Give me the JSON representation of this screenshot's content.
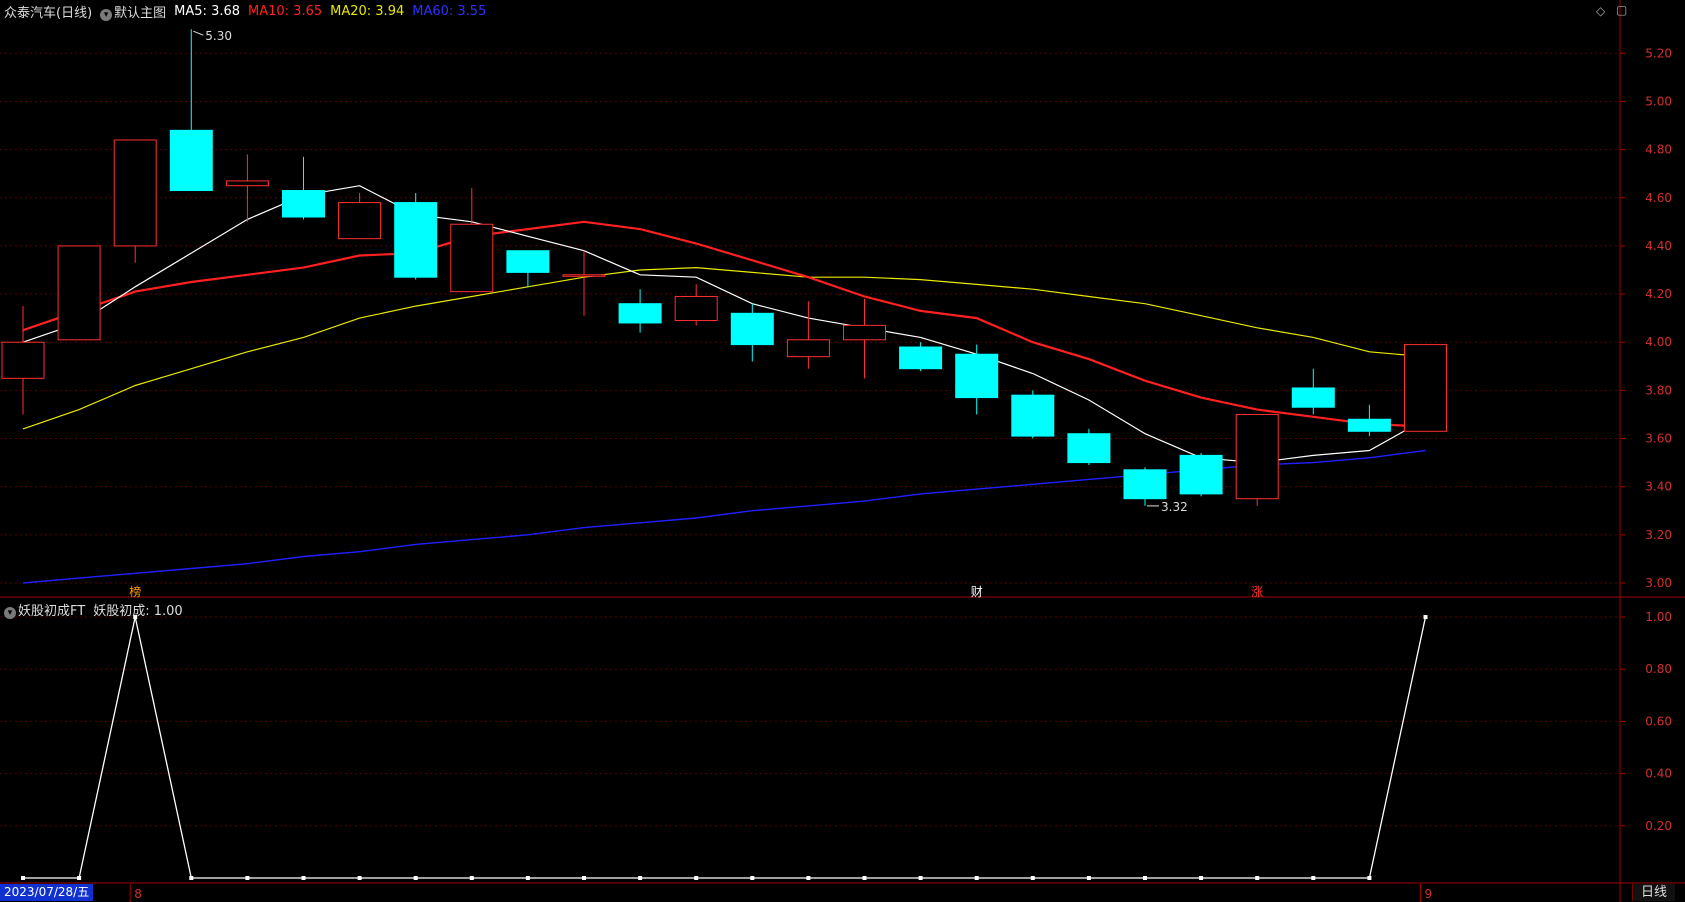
{
  "header": {
    "stock_name": "众泰汽车(日线)",
    "template_name": "默认主图",
    "ma5": {
      "label": "MA5: 3.68",
      "color": "#ffffff"
    },
    "ma10": {
      "label": "MA10: 3.65",
      "color": "#ff2020"
    },
    "ma20": {
      "label": "MA20: 3.94",
      "color": "#e8e800"
    },
    "ma60": {
      "label": "MA60: 3.55",
      "color": "#2020ff"
    },
    "controls": [
      "◇",
      "▢"
    ]
  },
  "sub_header": {
    "indicator_name": "妖股初成FT",
    "value_label": "妖股初成: 1.00"
  },
  "colors": {
    "up": "#ff3030",
    "down": "#00ffff",
    "axis": "#a00000",
    "grid": "#5a0000",
    "indicator_line": "#ffffff"
  },
  "price_axis": {
    "ticks": [
      "5.20",
      "5.00",
      "4.80",
      "4.60",
      "4.40",
      "4.20",
      "4.00",
      "3.80",
      "3.60",
      "3.40",
      "3.20",
      "3.00"
    ],
    "min": 2.95,
    "max": 5.33
  },
  "indicator_axis": {
    "ticks": [
      "1.00",
      "0.80",
      "0.60",
      "0.40",
      "0.20"
    ],
    "min": 0,
    "max": 1.05
  },
  "annotations": {
    "high_label": "5.30",
    "low_label": "3.32",
    "event_markers": [
      {
        "bar_index": 2,
        "text": "榜",
        "color": "#ff9900"
      },
      {
        "bar_index": 17,
        "text": "财",
        "color": "#ffffff"
      },
      {
        "bar_index": 22,
        "text": "涨",
        "color": "#ff3030"
      }
    ]
  },
  "chart_data": {
    "type": "candlestick",
    "ohlc": [
      {
        "o": 3.85,
        "h": 4.15,
        "l": 3.7,
        "c": 4.0
      },
      {
        "o": 4.01,
        "h": 4.4,
        "l": 4.01,
        "c": 4.4
      },
      {
        "o": 4.4,
        "h": 4.84,
        "l": 4.33,
        "c": 4.84
      },
      {
        "o": 4.88,
        "h": 5.3,
        "l": 4.63,
        "c": 4.63
      },
      {
        "o": 4.65,
        "h": 4.78,
        "l": 4.5,
        "c": 4.67
      },
      {
        "o": 4.63,
        "h": 4.77,
        "l": 4.51,
        "c": 4.52
      },
      {
        "o": 4.43,
        "h": 4.62,
        "l": 4.43,
        "c": 4.58
      },
      {
        "o": 4.58,
        "h": 4.62,
        "l": 4.26,
        "c": 4.27
      },
      {
        "o": 4.21,
        "h": 4.64,
        "l": 4.21,
        "c": 4.49
      },
      {
        "o": 4.38,
        "h": 4.38,
        "l": 4.23,
        "c": 4.29
      },
      {
        "o": 4.28,
        "h": 4.38,
        "l": 4.11,
        "c": 4.28
      },
      {
        "o": 4.16,
        "h": 4.22,
        "l": 4.04,
        "c": 4.08
      },
      {
        "o": 4.09,
        "h": 4.24,
        "l": 4.07,
        "c": 4.19
      },
      {
        "o": 4.12,
        "h": 4.16,
        "l": 3.92,
        "c": 3.99
      },
      {
        "o": 3.94,
        "h": 4.17,
        "l": 3.89,
        "c": 4.01
      },
      {
        "o": 4.01,
        "h": 4.18,
        "l": 3.85,
        "c": 4.07
      },
      {
        "o": 3.98,
        "h": 4.0,
        "l": 3.88,
        "c": 3.89
      },
      {
        "o": 3.95,
        "h": 3.99,
        "l": 3.7,
        "c": 3.77
      },
      {
        "o": 3.78,
        "h": 3.8,
        "l": 3.6,
        "c": 3.61
      },
      {
        "o": 3.62,
        "h": 3.64,
        "l": 3.49,
        "c": 3.5
      },
      {
        "o": 3.47,
        "h": 3.48,
        "l": 3.32,
        "c": 3.35
      },
      {
        "o": 3.53,
        "h": 3.54,
        "l": 3.36,
        "c": 3.37
      },
      {
        "o": 3.35,
        "h": 3.7,
        "l": 3.32,
        "c": 3.7
      },
      {
        "o": 3.81,
        "h": 3.89,
        "l": 3.7,
        "c": 3.73
      },
      {
        "o": 3.68,
        "h": 3.74,
        "l": 3.61,
        "c": 3.63
      },
      {
        "o": 3.63,
        "h": 3.99,
        "l": 3.63,
        "c": 3.99
      }
    ],
    "series": [
      {
        "name": "MA5",
        "values": [
          4.0,
          4.08,
          4.23,
          4.37,
          4.51,
          4.61,
          4.65,
          4.53,
          4.5,
          4.44,
          4.38,
          4.28,
          4.27,
          4.16,
          4.1,
          4.06,
          4.02,
          3.95,
          3.87,
          3.76,
          3.62,
          3.52,
          3.5,
          3.53,
          3.55,
          3.68
        ]
      },
      {
        "name": "MA10",
        "values": [
          4.05,
          4.13,
          4.21,
          4.25,
          4.28,
          4.31,
          4.36,
          4.37,
          4.44,
          4.47,
          4.5,
          4.47,
          4.41,
          4.34,
          4.27,
          4.19,
          4.13,
          4.1,
          4.0,
          3.93,
          3.84,
          3.77,
          3.72,
          3.69,
          3.66,
          3.65
        ]
      },
      {
        "name": "MA20",
        "values": [
          3.64,
          3.72,
          3.82,
          3.89,
          3.96,
          4.02,
          4.1,
          4.15,
          4.19,
          4.23,
          4.27,
          4.3,
          4.31,
          4.29,
          4.27,
          4.27,
          4.26,
          4.24,
          4.22,
          4.19,
          4.16,
          4.11,
          4.06,
          4.02,
          3.96,
          3.94
        ]
      },
      {
        "name": "MA60",
        "values": [
          3.0,
          3.02,
          3.04,
          3.06,
          3.08,
          3.11,
          3.13,
          3.16,
          3.18,
          3.2,
          3.23,
          3.25,
          3.27,
          3.3,
          3.32,
          3.34,
          3.37,
          3.39,
          3.41,
          3.43,
          3.45,
          3.47,
          3.49,
          3.5,
          3.52,
          3.55
        ]
      },
      {
        "name": "妖股初成",
        "values": [
          0,
          0,
          1,
          0,
          0,
          0,
          0,
          0,
          0,
          0,
          0,
          0,
          0,
          0,
          0,
          0,
          0,
          0,
          0,
          0,
          0,
          0,
          0,
          0,
          0,
          1
        ]
      }
    ]
  },
  "bottom_bar": {
    "date_label": "2023/07/28/五",
    "month_labels": [
      {
        "bar_index": 2,
        "text": "8"
      },
      {
        "bar_index": 25,
        "text": "9"
      }
    ],
    "period_label": "日线"
  }
}
